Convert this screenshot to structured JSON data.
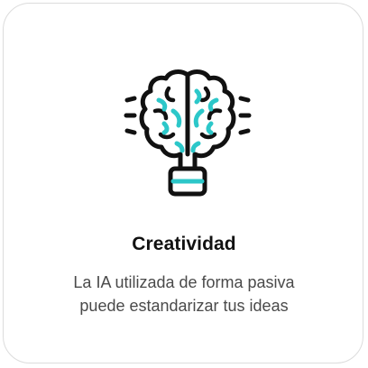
{
  "card": {
    "title": "Creatividad",
    "description_lines": [
      "La IA utilizada de forma pasiva",
      "puede estandarizar tus ideas"
    ],
    "icon": "brain-lightbulb-icon"
  },
  "colors": {
    "outline": "#111111",
    "accent": "#2cc7c9",
    "border": "#dcdcdc"
  }
}
